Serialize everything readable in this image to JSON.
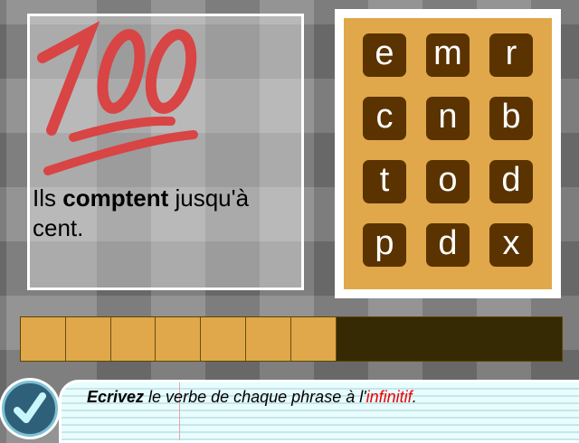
{
  "sentence": {
    "before": "Ils ",
    "verb": "comptent",
    "after": " jusqu'à cent."
  },
  "emoji": "100",
  "letters": [
    "e",
    "m",
    "r",
    "c",
    "n",
    "b",
    "t",
    "o",
    "d",
    "p",
    "d",
    "x"
  ],
  "progress": {
    "filled": 7,
    "total": 12
  },
  "instruction": {
    "bold": "Ecrivez",
    "text": " le verbe de chaque phrase à l'",
    "highlight": "infinitif",
    "end": "."
  },
  "colors": {
    "tile": "#5a3300",
    "board": "#e0a84a",
    "bar": "#352a03"
  }
}
